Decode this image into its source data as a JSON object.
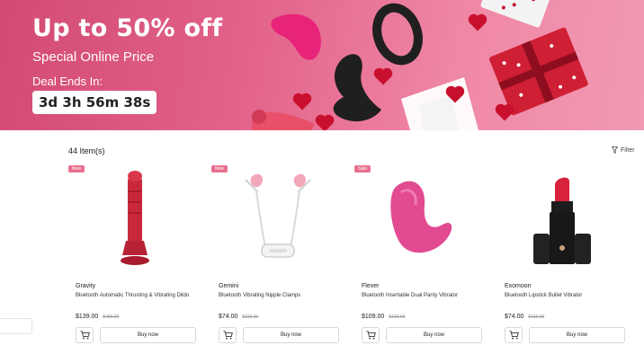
{
  "banner": {
    "title": "Up to 50% off",
    "subtitle": "Special Online Price",
    "deal_label": "Deal Ends In:",
    "countdown": "3d 3h 56m 38s"
  },
  "listing": {
    "count": "44 Item(s)",
    "filter_label": "Filter"
  },
  "colors": {
    "accent": "#e8708f",
    "banner_pink": "#e2628a"
  },
  "products": [
    {
      "badge": "New",
      "name": "Gravity",
      "description": "Bluetooth Automatic Thrusting & Vibrating Dildo",
      "price": "$139.00",
      "old_price": "$459.00",
      "cart_icon": "cart-icon",
      "buy_label": "Buy now"
    },
    {
      "badge": "New",
      "name": "Gemini",
      "description": "Bluetooth Vibrating Nipple Clamps",
      "price": "$74.00",
      "old_price": "$115.00",
      "cart_icon": "cart-icon",
      "buy_label": "Buy now"
    },
    {
      "badge": "Sale",
      "name": "Flexer",
      "description": "Bluetooth Insertable Dual Panty Vibrator",
      "price": "$109.00",
      "old_price": "$139.00",
      "cart_icon": "cart-icon",
      "buy_label": "Buy now"
    },
    {
      "badge": "",
      "name": "Exomoon",
      "description": "Bluetooth Lipstick Bullet Vibrator",
      "price": "$74.00",
      "old_price": "$115.00",
      "cart_icon": "cart-icon",
      "buy_label": "Buy now"
    }
  ]
}
